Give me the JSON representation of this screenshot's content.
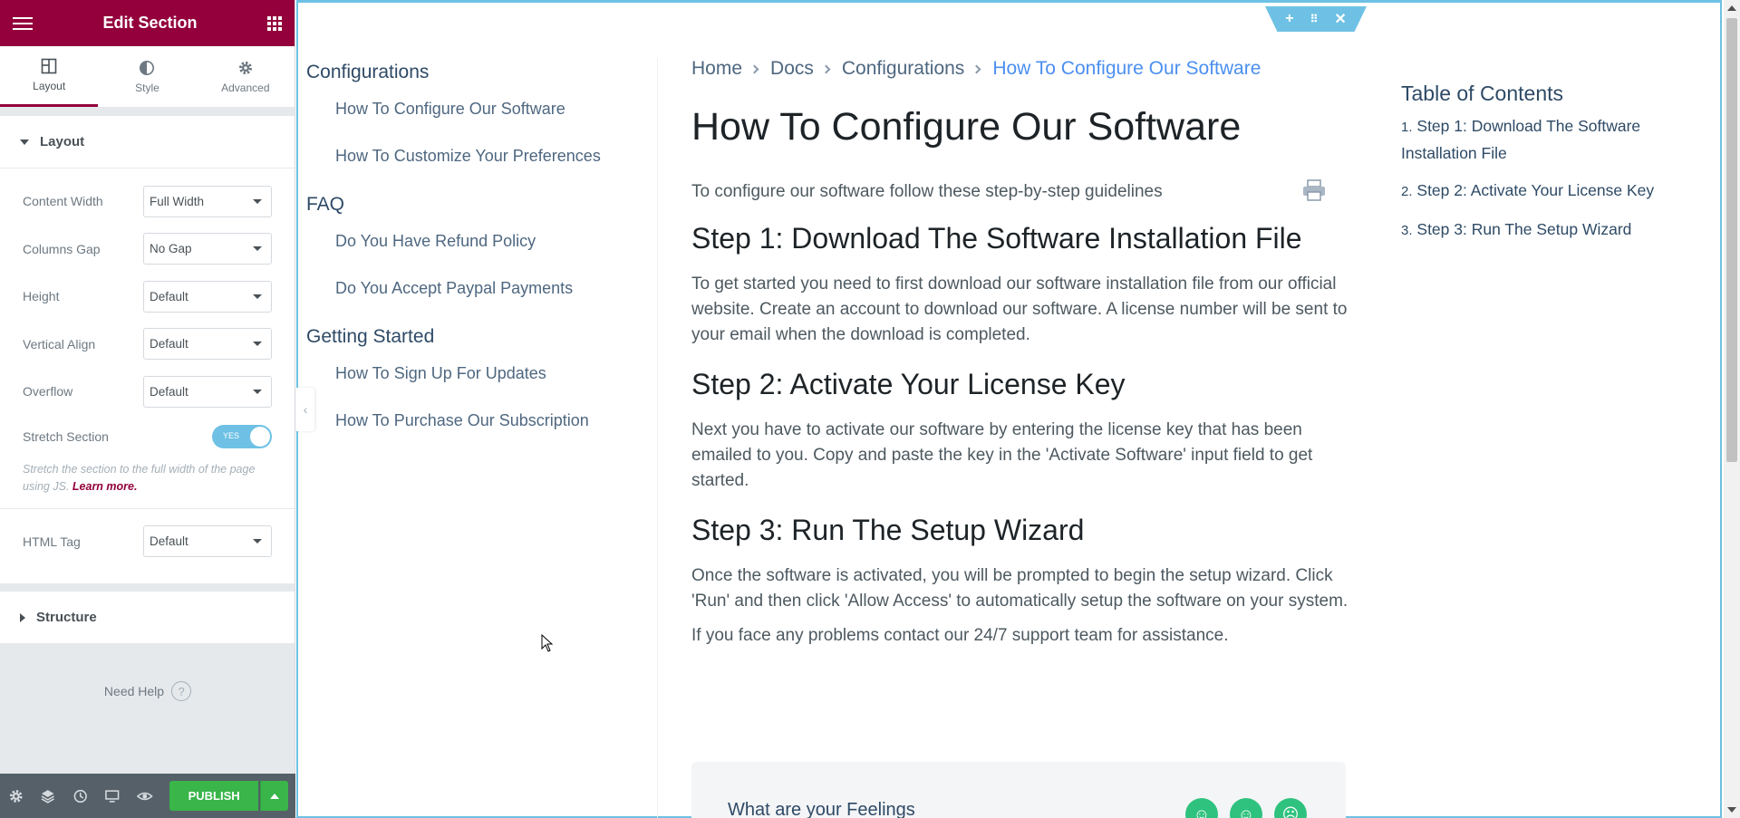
{
  "panel": {
    "title": "Edit Section",
    "tabs": [
      {
        "label": "Layout",
        "icon": "layout-icon"
      },
      {
        "label": "Style",
        "icon": "contrast-icon"
      },
      {
        "label": "Advanced",
        "icon": "gear-icon"
      }
    ],
    "layout_section": "Layout",
    "controls": {
      "content_width": {
        "label": "Content Width",
        "value": "Full Width"
      },
      "columns_gap": {
        "label": "Columns Gap",
        "value": "No Gap"
      },
      "height": {
        "label": "Height",
        "value": "Default"
      },
      "vertical_align": {
        "label": "Vertical Align",
        "value": "Default"
      },
      "overflow": {
        "label": "Overflow",
        "value": "Default"
      },
      "stretch_section": {
        "label": "Stretch Section",
        "toggle_text": "YES",
        "on": true
      },
      "stretch_desc": "Stretch the section to the full width of the page using JS.",
      "learn_more": "Learn more.",
      "html_tag": {
        "label": "HTML Tag",
        "value": "Default"
      }
    },
    "structure_section": "Structure",
    "need_help": "Need Help",
    "publish": "PUBLISH",
    "accent_color": "#93003c",
    "publish_color": "#39b54a"
  },
  "docs_nav": {
    "categories": [
      {
        "title": "Configurations",
        "items": [
          "How To Configure Our Software",
          "How To Customize Your Preferences"
        ]
      },
      {
        "title": "FAQ",
        "items": [
          "Do You Have Refund Policy",
          "Do You Accept Paypal Payments"
        ]
      },
      {
        "title": "Getting Started",
        "items": [
          "How To Sign Up For Updates",
          "How To Purchase Our Subscription"
        ]
      }
    ]
  },
  "breadcrumb": [
    "Home",
    "Docs",
    "Configurations",
    "How To Configure Our Software"
  ],
  "article": {
    "title": "How To Configure Our Software",
    "intro": "To configure our software follow these step-by-step guidelines",
    "step1_title": "Step 1: Download The Software Installation File",
    "step1_body": "To get started you need to first download our software installation file from our official website. Create an account to download our software. A license number will be sent to your email when the download is completed.",
    "step2_title": "Step 2: Activate Your License Key",
    "step2_body": "Next you have to activate our software by entering the license key that has been emailed to you. Copy and paste the key in the 'Activate Software' input field to get started.",
    "step3_title": "Step 3: Run The Setup Wizard",
    "step3_body": "Once the software is activated, you will be prompted to begin the setup wizard. Click 'Run' and then click 'Allow Access' to automatically setup the software on your system.",
    "closing": "If you face any problems contact our 24/7 support team for assistance.",
    "feedback_title": "What are your Feelings"
  },
  "toc": {
    "title": "Table of Contents",
    "items": [
      {
        "num": "1.",
        "label": "Step 1: Download The Software Installation File"
      },
      {
        "num": "2.",
        "label": "Step 2: Activate Your License Key"
      },
      {
        "num": "3.",
        "label": "Step 3: Run The Setup Wizard"
      }
    ]
  },
  "editor_accent": "#6ec1e4"
}
